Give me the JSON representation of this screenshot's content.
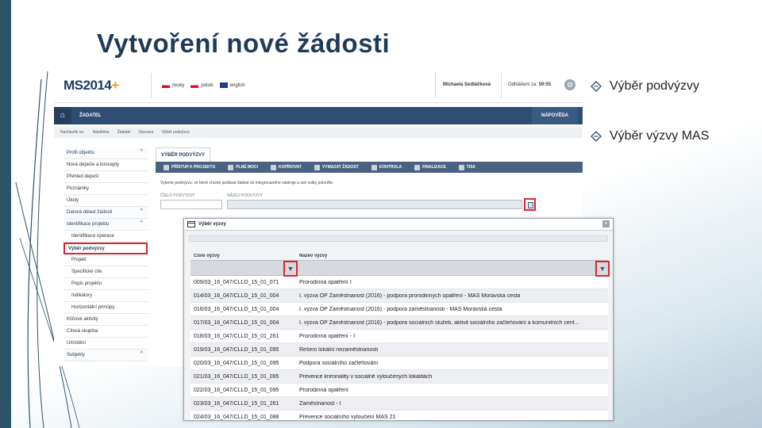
{
  "slide": {
    "title": "Vytvoření nové žádosti",
    "bullets": [
      {
        "text": "Výběr podvýzvy"
      },
      {
        "text": "Výběr výzvy MAS"
      }
    ]
  },
  "app": {
    "logo": "MS2014",
    "logo_plus": "+",
    "languages": [
      "česky",
      "polski",
      "english"
    ],
    "user_name": "Michaela Sedláčková",
    "logout_label": "Odhlášení za:",
    "logout_time": "59:55",
    "nav": {
      "role": "ŽADATEL",
      "help": "NÁPOVĚDA"
    },
    "breadcrumb": [
      "Nacházíte se:",
      "Nástěnka",
      "Žadatel",
      "Operace",
      "Výběr podvýzvy"
    ],
    "sidebar": [
      {
        "label": "Profil objektu",
        "type": "head"
      },
      {
        "label": "Nová depeše a koncepty",
        "type": "item"
      },
      {
        "label": "Přehled depeší",
        "type": "item"
      },
      {
        "label": "Poznámky",
        "type": "item"
      },
      {
        "label": "Úkoly",
        "type": "item"
      },
      {
        "label": "Datová oblast žádosti",
        "type": "head"
      },
      {
        "label": "Identifikace projektu",
        "type": "head"
      },
      {
        "label": "Identifikace operace",
        "type": "sub"
      },
      {
        "label": "Výběr podvýzvy",
        "type": "active"
      },
      {
        "label": "Projekt",
        "type": "sub"
      },
      {
        "label": "Specifické cíle",
        "type": "sub"
      },
      {
        "label": "Popis projektu",
        "type": "sub"
      },
      {
        "label": "Indikátory",
        "type": "sub"
      },
      {
        "label": "Horizontální principy",
        "type": "sub"
      },
      {
        "label": "Klíčové aktivity",
        "type": "item"
      },
      {
        "label": "Cílová skupina",
        "type": "item"
      },
      {
        "label": "Umístění",
        "type": "item"
      },
      {
        "label": "Subjekty",
        "type": "head"
      }
    ],
    "main": {
      "tab": "VÝBĚR PODVÝZVY",
      "toolbar": [
        "PŘÍSTUP K PROJEKTU",
        "PLNÉ MOCI",
        "KOPÍROVAT",
        "VYMAZAT ŽÁDOST",
        "KONTROLA",
        "FINALIZACE",
        "TISK"
      ],
      "info": "Vyberte podvýzvu, ve které chcete podávat žádost do integrovaného nástroje a své volby potvrďte.",
      "field1_label": "ČÍSLO PODVÝZVY",
      "field2_label": "NÁZEV PODVÝZVY"
    }
  },
  "dialog": {
    "title": "Výběr výzvy",
    "col1": "Číslo výzvy",
    "col2": "Název výzvy",
    "filter_icon": "funnel-icon",
    "rows": [
      {
        "num": "009/03_16_047/CLLD_15_01_071",
        "name": "Prorodinná opatření I"
      },
      {
        "num": "014/03_16_047/CLLD_15_01_004",
        "name": "I. výzva OP Zaměstnanost (2016) - podpora prorodinných opatření - MAS Moravská cesta"
      },
      {
        "num": "016/03_16_047/CLLD_15_01_004",
        "name": "I. výzva OP Zaměstnanost (2016) - podpora zaměstnanosti - MAS Moravská cesta"
      },
      {
        "num": "017/03_16_047/CLLD_15_01_004",
        "name": "I. výzva OP Zaměstnanost (2016) - podpora sociálních služeb, aktivit sociálního začleňování a komunitních cent..."
      },
      {
        "num": "018/03_16_047/CLLD_15_01_261",
        "name": "Prorodinná opatření - I"
      },
      {
        "num": "019/03_16_047/CLLD_15_01_095",
        "name": "Řešení lokální nezaměstnanosti"
      },
      {
        "num": "020/03_16_047/CLLD_15_01_095",
        "name": "Podpora sociálního začleňování"
      },
      {
        "num": "021/03_16_047/CLLD_15_01_095",
        "name": "Prevence kriminality v sociálně vyloučených lokalitách"
      },
      {
        "num": "022/03_16_047/CLLD_15_01_095",
        "name": "Prorodinná opatření"
      },
      {
        "num": "023/03_16_047/CLLD_15_01_261",
        "name": "Zaměstnanost - I"
      },
      {
        "num": "024/03_16_047/CLLD_15_01_088",
        "name": "Prevence sociálního vyloučení MAS 21"
      }
    ]
  }
}
